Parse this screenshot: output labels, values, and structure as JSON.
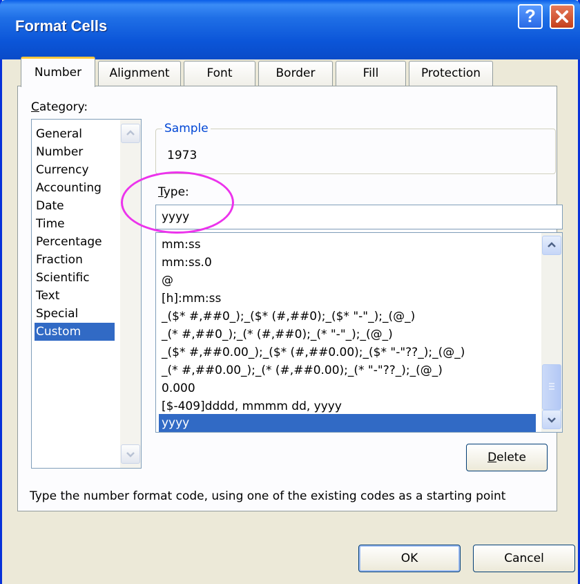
{
  "dialog": {
    "title": "Format Cells"
  },
  "tabs": [
    {
      "label": "Number"
    },
    {
      "label": "Alignment"
    },
    {
      "label": "Font"
    },
    {
      "label": "Border"
    },
    {
      "label": "Fill"
    },
    {
      "label": "Protection"
    }
  ],
  "category": {
    "label_key": "C",
    "label_rest": "ategory:",
    "items": [
      "General",
      "Number",
      "Currency",
      "Accounting",
      "Date",
      "Time",
      "Percentage",
      "Fraction",
      "Scientific",
      "Text",
      "Special",
      "Custom"
    ],
    "selected": "Custom"
  },
  "sample": {
    "legend": "Sample",
    "value": "1973"
  },
  "type": {
    "label_key": "T",
    "label_rest": "ype:",
    "value": "yyyy"
  },
  "formats": {
    "items": [
      "mm:ss",
      "mm:ss.0",
      "@",
      "[h]:mm:ss",
      "_($* #,##0_);_($* (#,##0);_($* \"-\"_);_(@_)",
      "_(* #,##0_);_(* (#,##0);_(* \"-\"_);_(@_)",
      "_($* #,##0.00_);_($* (#,##0.00);_($* \"-\"??_);_(@_)",
      "_(* #,##0.00_);_(* (#,##0.00);_(* \"-\"??_);_(@_)",
      "0.000",
      "[$-409]dddd, mmmm dd, yyyy",
      "yyyy"
    ],
    "selected": "yyyy"
  },
  "buttons": {
    "delete_key": "D",
    "delete_rest": "elete",
    "ok": "OK",
    "cancel": "Cancel"
  },
  "hint": "Type the number format code, using one of the existing codes as a starting point",
  "colors": {
    "titlebar": "#0a5ee8",
    "selection": "#316ac5",
    "annotation": "#ec33ec",
    "active_tab_accent": "#ffc83c"
  }
}
